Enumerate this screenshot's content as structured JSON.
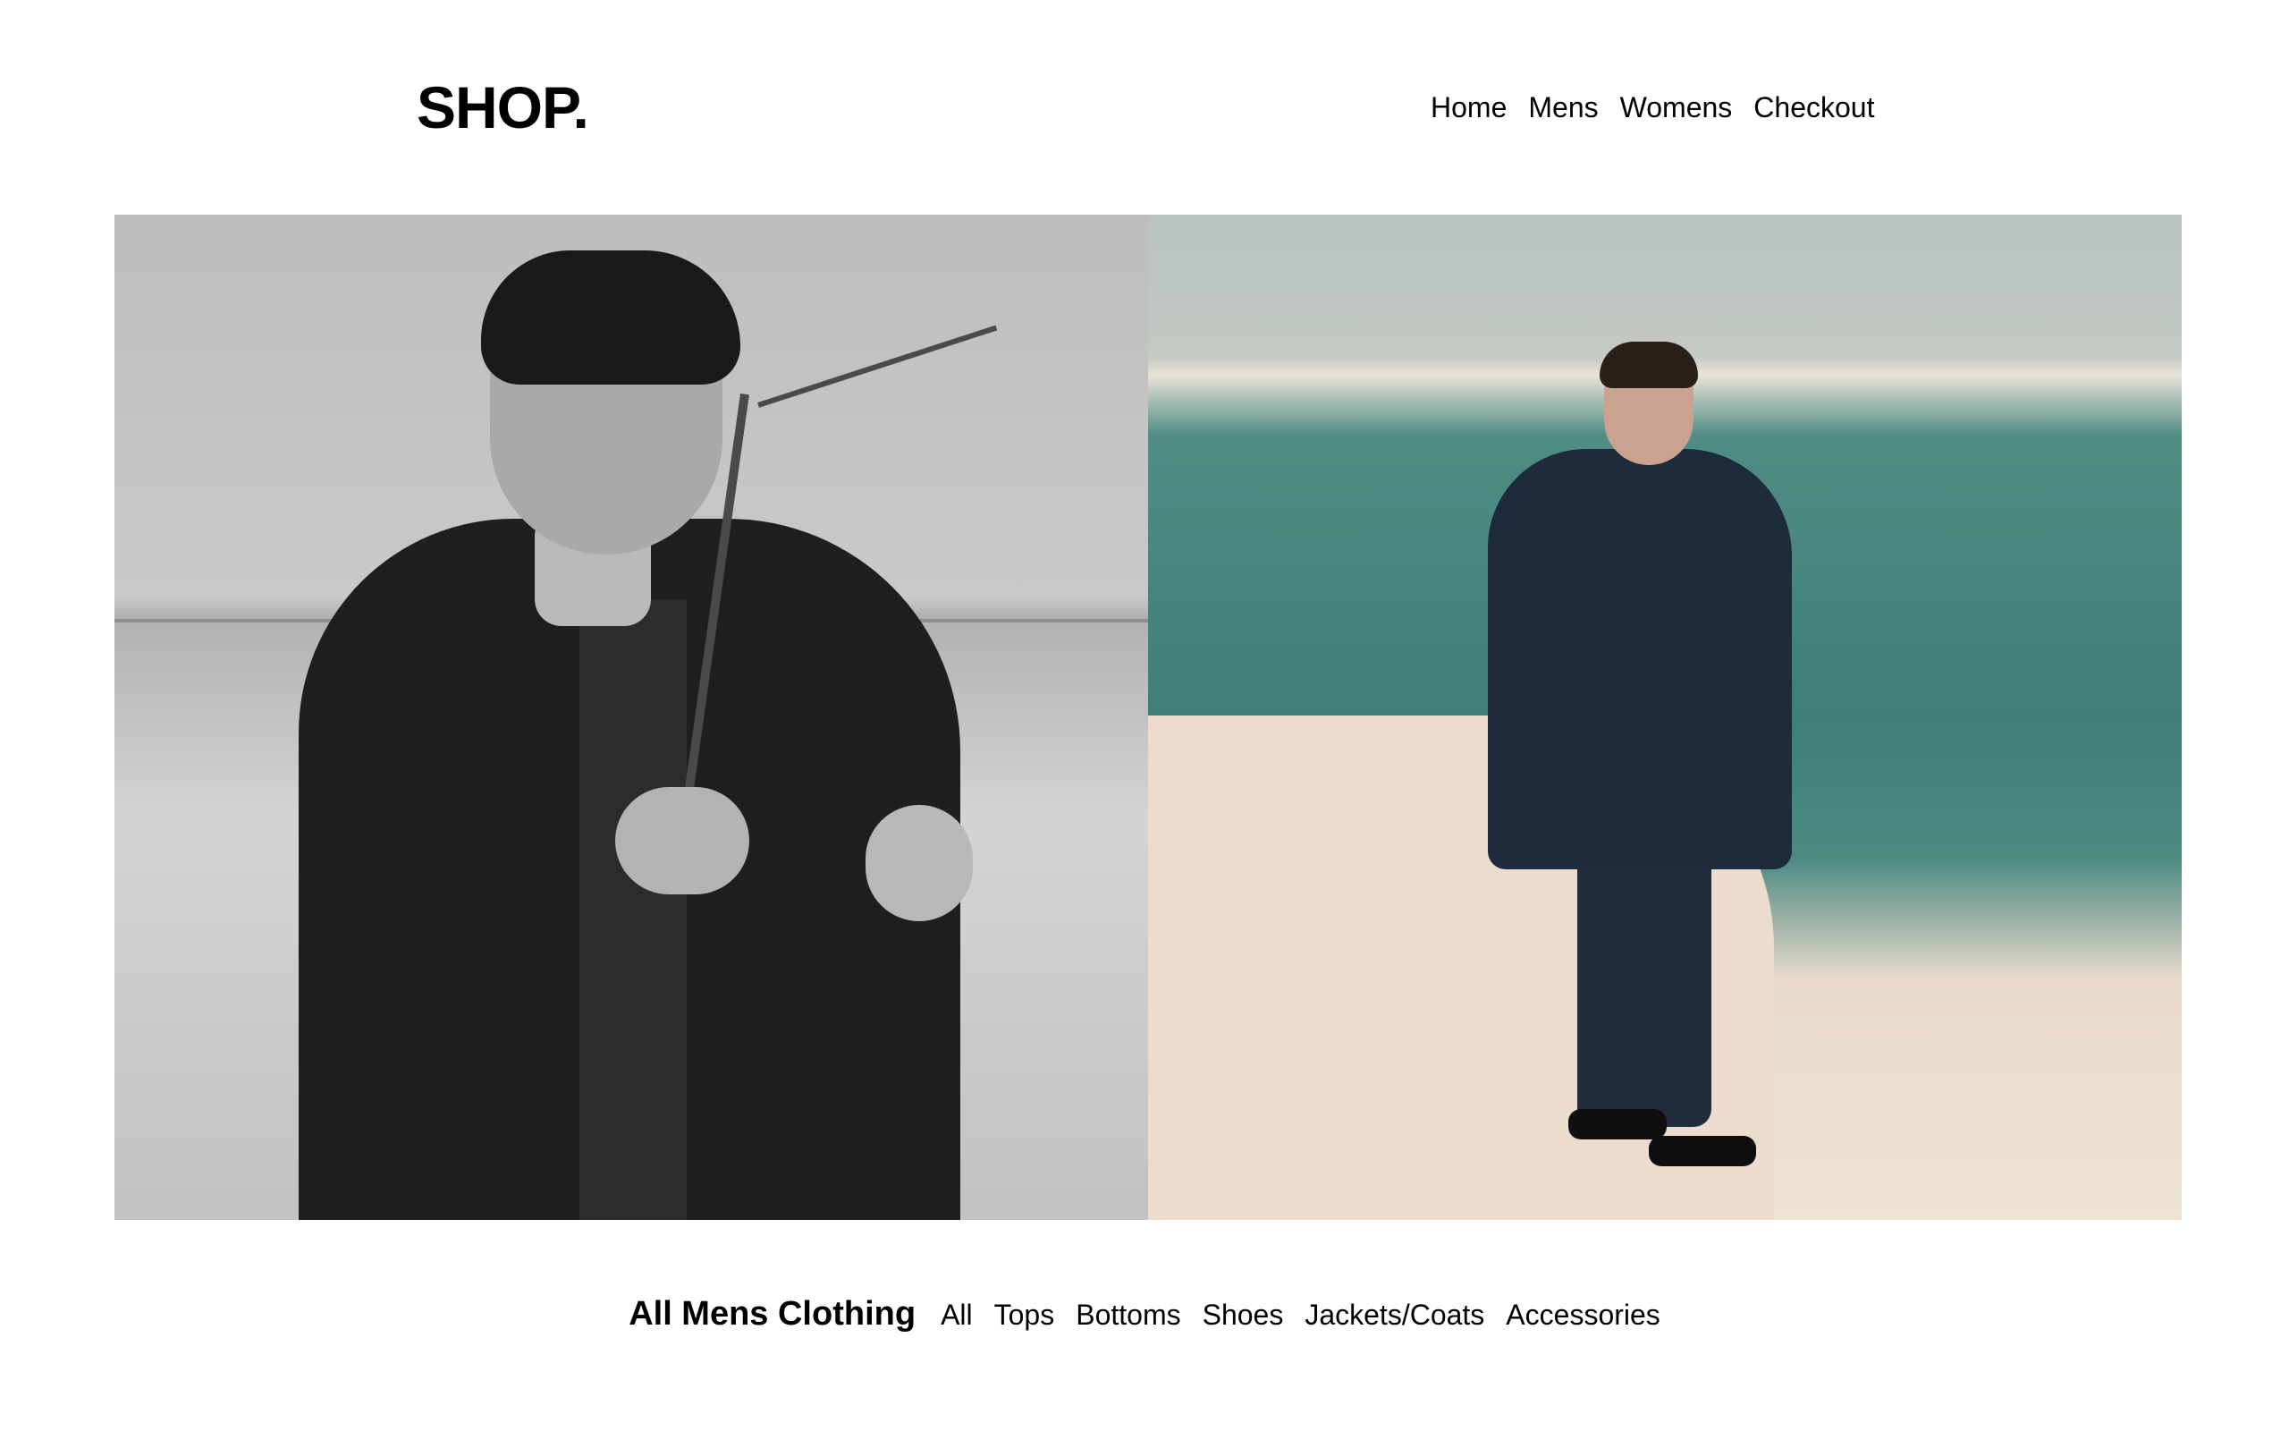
{
  "header": {
    "logo": "SHOP.",
    "nav": [
      "Home",
      "Mens",
      "Womens",
      "Checkout"
    ]
  },
  "hero": {
    "left_image": "model in black coat holding branch (black and white)",
    "right_image": "model in navy coat standing on salt flats by the sea"
  },
  "categories": {
    "title": "All Mens Clothing",
    "links": [
      "All",
      "Tops",
      "Bottoms",
      "Shoes",
      "Jackets/Coats",
      "Accessories"
    ]
  }
}
